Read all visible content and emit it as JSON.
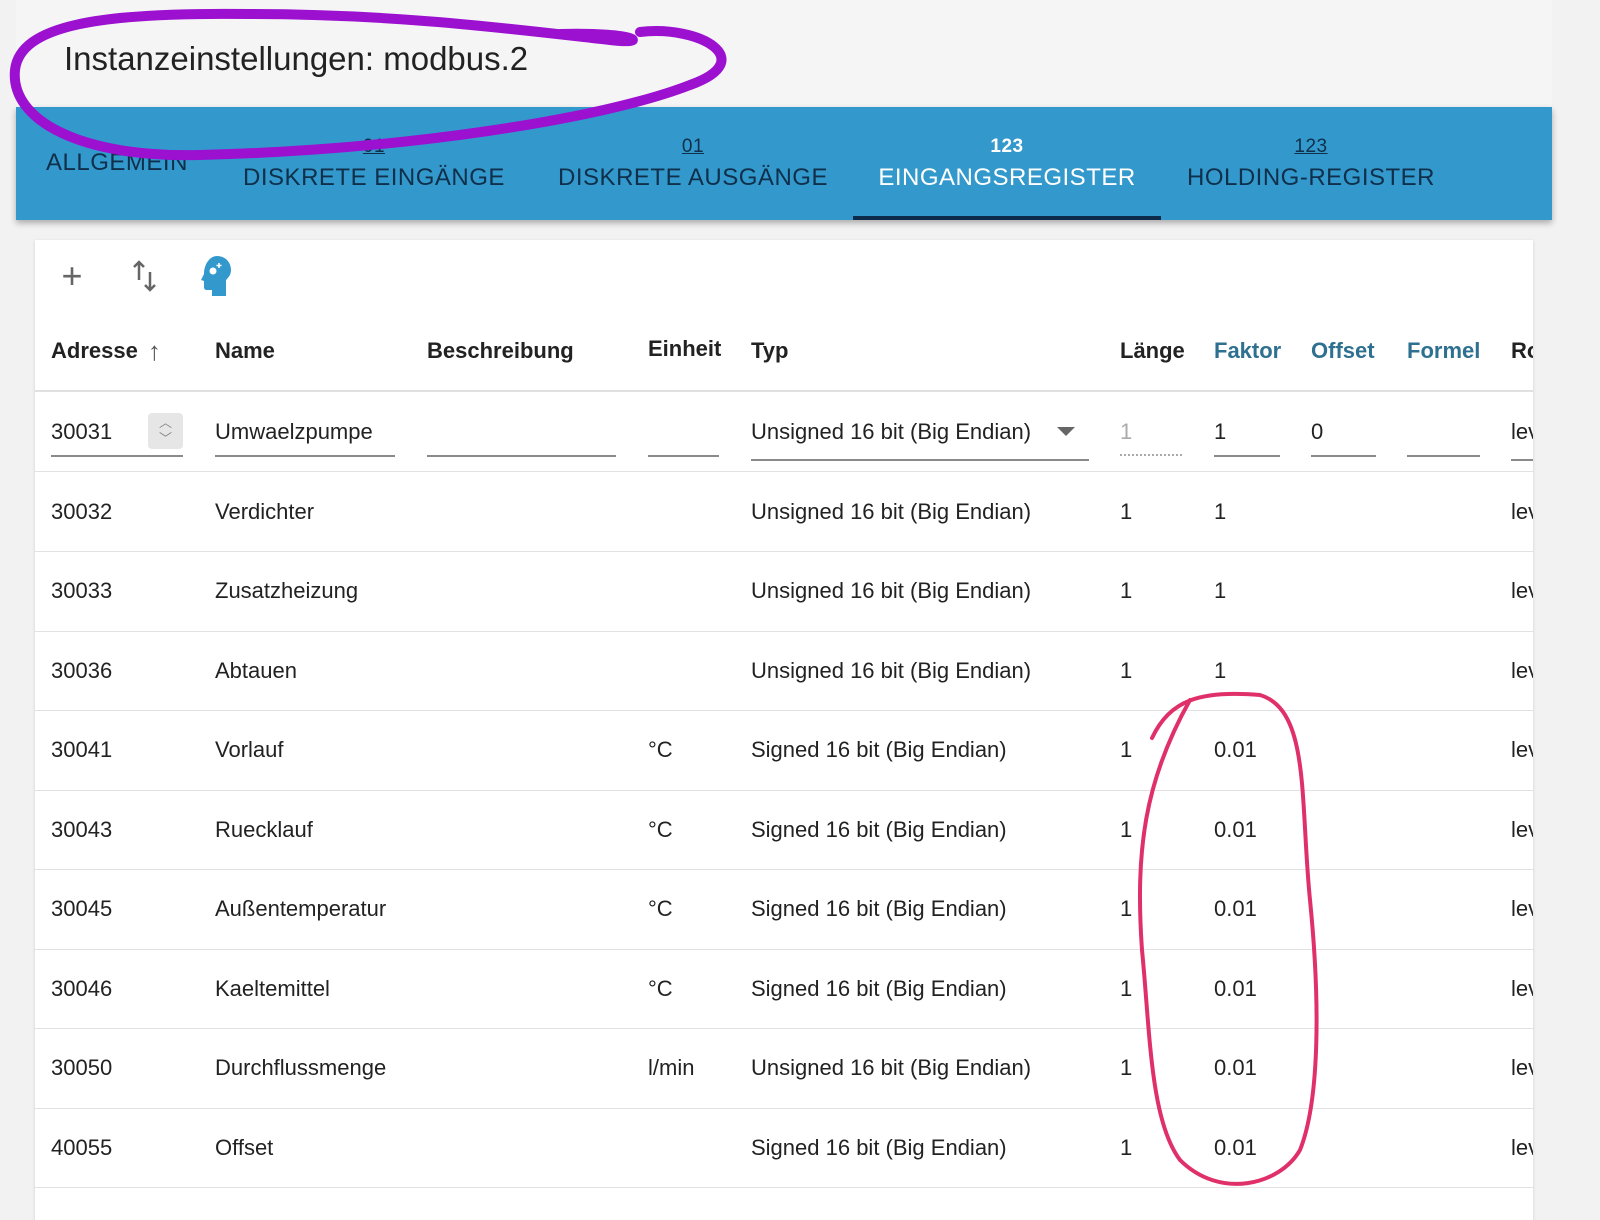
{
  "title": "Instanzeinstellungen: modbus.2",
  "tabs": [
    {
      "icon": "",
      "label": "Allgemein"
    },
    {
      "icon": "01",
      "label": "Diskrete Eingänge"
    },
    {
      "icon": "01",
      "label": "Diskrete Ausgänge"
    },
    {
      "icon": "123",
      "label": "Eingangsregister"
    },
    {
      "icon": "123",
      "label": "Holding-Register"
    }
  ],
  "columns": [
    "Adresse",
    "Name",
    "Beschreibung",
    "Einheit",
    "Typ",
    "Länge",
    "Faktor",
    "Offset",
    "Formel",
    "Ro"
  ],
  "edit_row": {
    "address": "30031",
    "name": "Umwaelzpumpe",
    "description": "",
    "unit": "",
    "type": "Unsigned 16 bit (Big Endian)",
    "length": "1",
    "factor": "1",
    "offset": "0",
    "formula": "",
    "role": "lev"
  },
  "rows": [
    {
      "address": "30032",
      "name": "Verdichter",
      "unit": "",
      "type": "Unsigned 16 bit (Big Endian)",
      "length": "1",
      "factor": "1",
      "role": "lev"
    },
    {
      "address": "30033",
      "name": "Zusatzheizung",
      "unit": "",
      "type": "Unsigned 16 bit (Big Endian)",
      "length": "1",
      "factor": "1",
      "role": "lev"
    },
    {
      "address": "30036",
      "name": "Abtauen",
      "unit": "",
      "type": "Unsigned 16 bit (Big Endian)",
      "length": "1",
      "factor": "1",
      "role": "lev"
    },
    {
      "address": "30041",
      "name": "Vorlauf",
      "unit": "°C",
      "type": "Signed 16 bit (Big Endian)",
      "length": "1",
      "factor": "0.01",
      "role": "lev"
    },
    {
      "address": "30043",
      "name": "Ruecklauf",
      "unit": "°C",
      "type": "Signed 16 bit (Big Endian)",
      "length": "1",
      "factor": "0.01",
      "role": "lev"
    },
    {
      "address": "30045",
      "name": "Außentemperatur",
      "unit": "°C",
      "type": "Signed 16 bit (Big Endian)",
      "length": "1",
      "factor": "0.01",
      "role": "lev"
    },
    {
      "address": "30046",
      "name": "Kaeltemittel",
      "unit": "°C",
      "type": "Signed 16 bit (Big Endian)",
      "length": "1",
      "factor": "0.01",
      "role": "lev"
    },
    {
      "address": "30050",
      "name": "Durchflussmenge",
      "unit": "l/min",
      "type": "Unsigned 16 bit (Big Endian)",
      "length": "1",
      "factor": "0.01",
      "role": "lev"
    },
    {
      "address": "40055",
      "name": "Offset",
      "unit": "",
      "type": "Signed 16 bit (Big Endian)",
      "length": "1",
      "factor": "0.01",
      "role": "lev"
    }
  ]
}
